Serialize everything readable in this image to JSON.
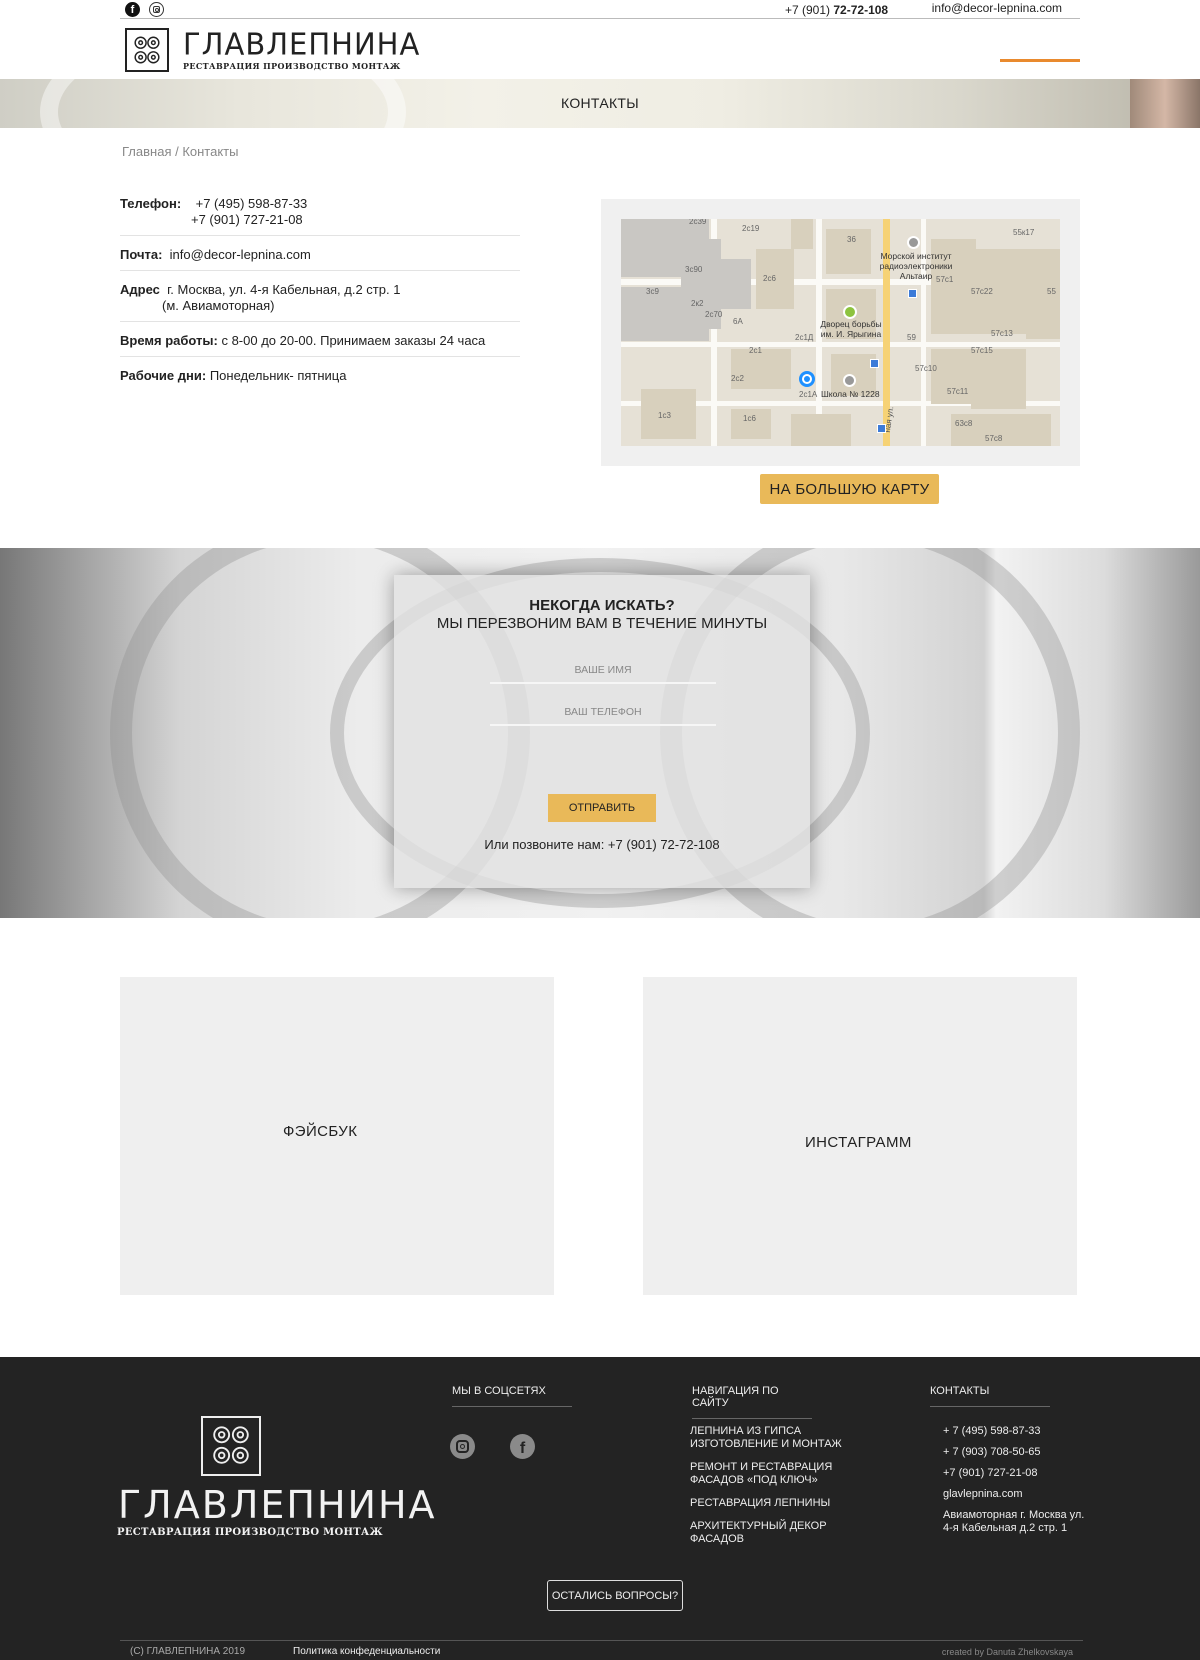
{
  "topbar": {
    "phone_prefix": "+7 (901) ",
    "phone_main": "72-72-108",
    "email": "info@decor-lepnina.com"
  },
  "logo": {
    "name": "ГЛАВЛЕПНИНА",
    "tagline": "РЕСТАВРАЦИЯ ПРОИЗВОДСТВО МОНТАЖ"
  },
  "banner": {
    "title": "КОНТАКТЫ"
  },
  "breadcrumb": "Главная / Контакты",
  "contacts": {
    "phone_label": "Телефон:",
    "phone_1": "+7 (495) 598-87-33",
    "phone_2": "+7 (901) 727-21-08",
    "mail_label": "Почта:",
    "mail_value": "info@decor-lepnina.com",
    "address_label": "Адрес",
    "address_value": "г. Москва, ул. 4-я  Кабельная, д.2 стр. 1",
    "address_metro": "(м. Авиамоторная)",
    "hours_label": "Время работы:",
    "hours_value": "с 8-00 до 20-00. Принимаем заказы 24 часа",
    "days_label": "Рабочие дни:",
    "days_value": "Понедельник- пятница"
  },
  "map": {
    "button_label": "НА БОЛЬШУЮ КАРТУ",
    "labels": {
      "l2c19": "2c19",
      "l2c39": "2c39",
      "l36": "36",
      "l55k17": "55к17",
      "l3c90": "3c90",
      "l2c6": "2c6",
      "l3c9": "3c9",
      "l2k2": "2к2",
      "l2c70": "2c70",
      "l6A": "6А",
      "l2c1D": "2с1Д",
      "l2c1": "2с1",
      "l59": "59",
      "l57c1": "57c1",
      "l57c22": "57c22",
      "l55": "55",
      "l57c13": "57c13",
      "l57c15": "57c15",
      "l57c10": "57c10",
      "l57c11": "57c11",
      "l2c2": "2c2",
      "l2c1A": "2с1А",
      "l1c3": "1c3",
      "l1c6": "1c6",
      "l63c8": "63c8",
      "l57c8": "57c8",
      "institute": "Морской институт радиоэлектроники Альтаир",
      "palace": "Дворец борьбы им. И. Ярыгина",
      "school": "Школа № 1228",
      "street": "ная ул."
    }
  },
  "callback": {
    "title": "НЕКОГДА ИСКАТЬ?",
    "subtitle": "МЫ ПЕРЕЗВОНИМ ВАМ В ТЕЧЕНИЕ МИНУТЫ",
    "name_placeholder": "ВАШЕ ИМЯ",
    "phone_placeholder": "ВАШ ТЕЛЕФОН",
    "send_label": "ОТПРАВИТЬ",
    "call_text": "Или позвоните нам: +7 (901) 72-72-108"
  },
  "social_panels": {
    "facebook": "ФЭЙСБУК",
    "instagram": "ИНСТАГРАММ"
  },
  "footer": {
    "social_title": "МЫ В СОЦСЕТЯХ",
    "nav_title": "НАВИГАЦИЯ ПО САЙТУ",
    "contacts_title": "КОНТАКТЫ",
    "nav_items": [
      "ЛЕПНИНА ИЗ ГИПСА ИЗГОТОВЛЕНИЕ И МОНТАЖ",
      "РЕМОНТ И РЕСТАВРАЦИЯ ФАСАДОВ «ПОД КЛЮЧ»",
      "РЕСТАВРАЦИЯ ЛЕПНИНЫ",
      "АРХИТЕКТУРНЫЙ  ДЕКОР ФАСАДОВ"
    ],
    "contacts": [
      "+ 7 (495) 598-87-33",
      "+ 7 (903) 708-50-65",
      "+7 (901) 727-21-08",
      "glavlepnina.com",
      "Авиамоторная г. Москва ул. 4-я Кабельная д.2 стр. 1"
    ],
    "question_button": "ОСТАЛИСЬ ВОПРОСЫ?",
    "copyright": "(C) ГЛАВЛЕПНИНА 2019",
    "policy": "Политика конфеденциальности",
    "credit": "created by Danuta Zhelkovskaya"
  }
}
